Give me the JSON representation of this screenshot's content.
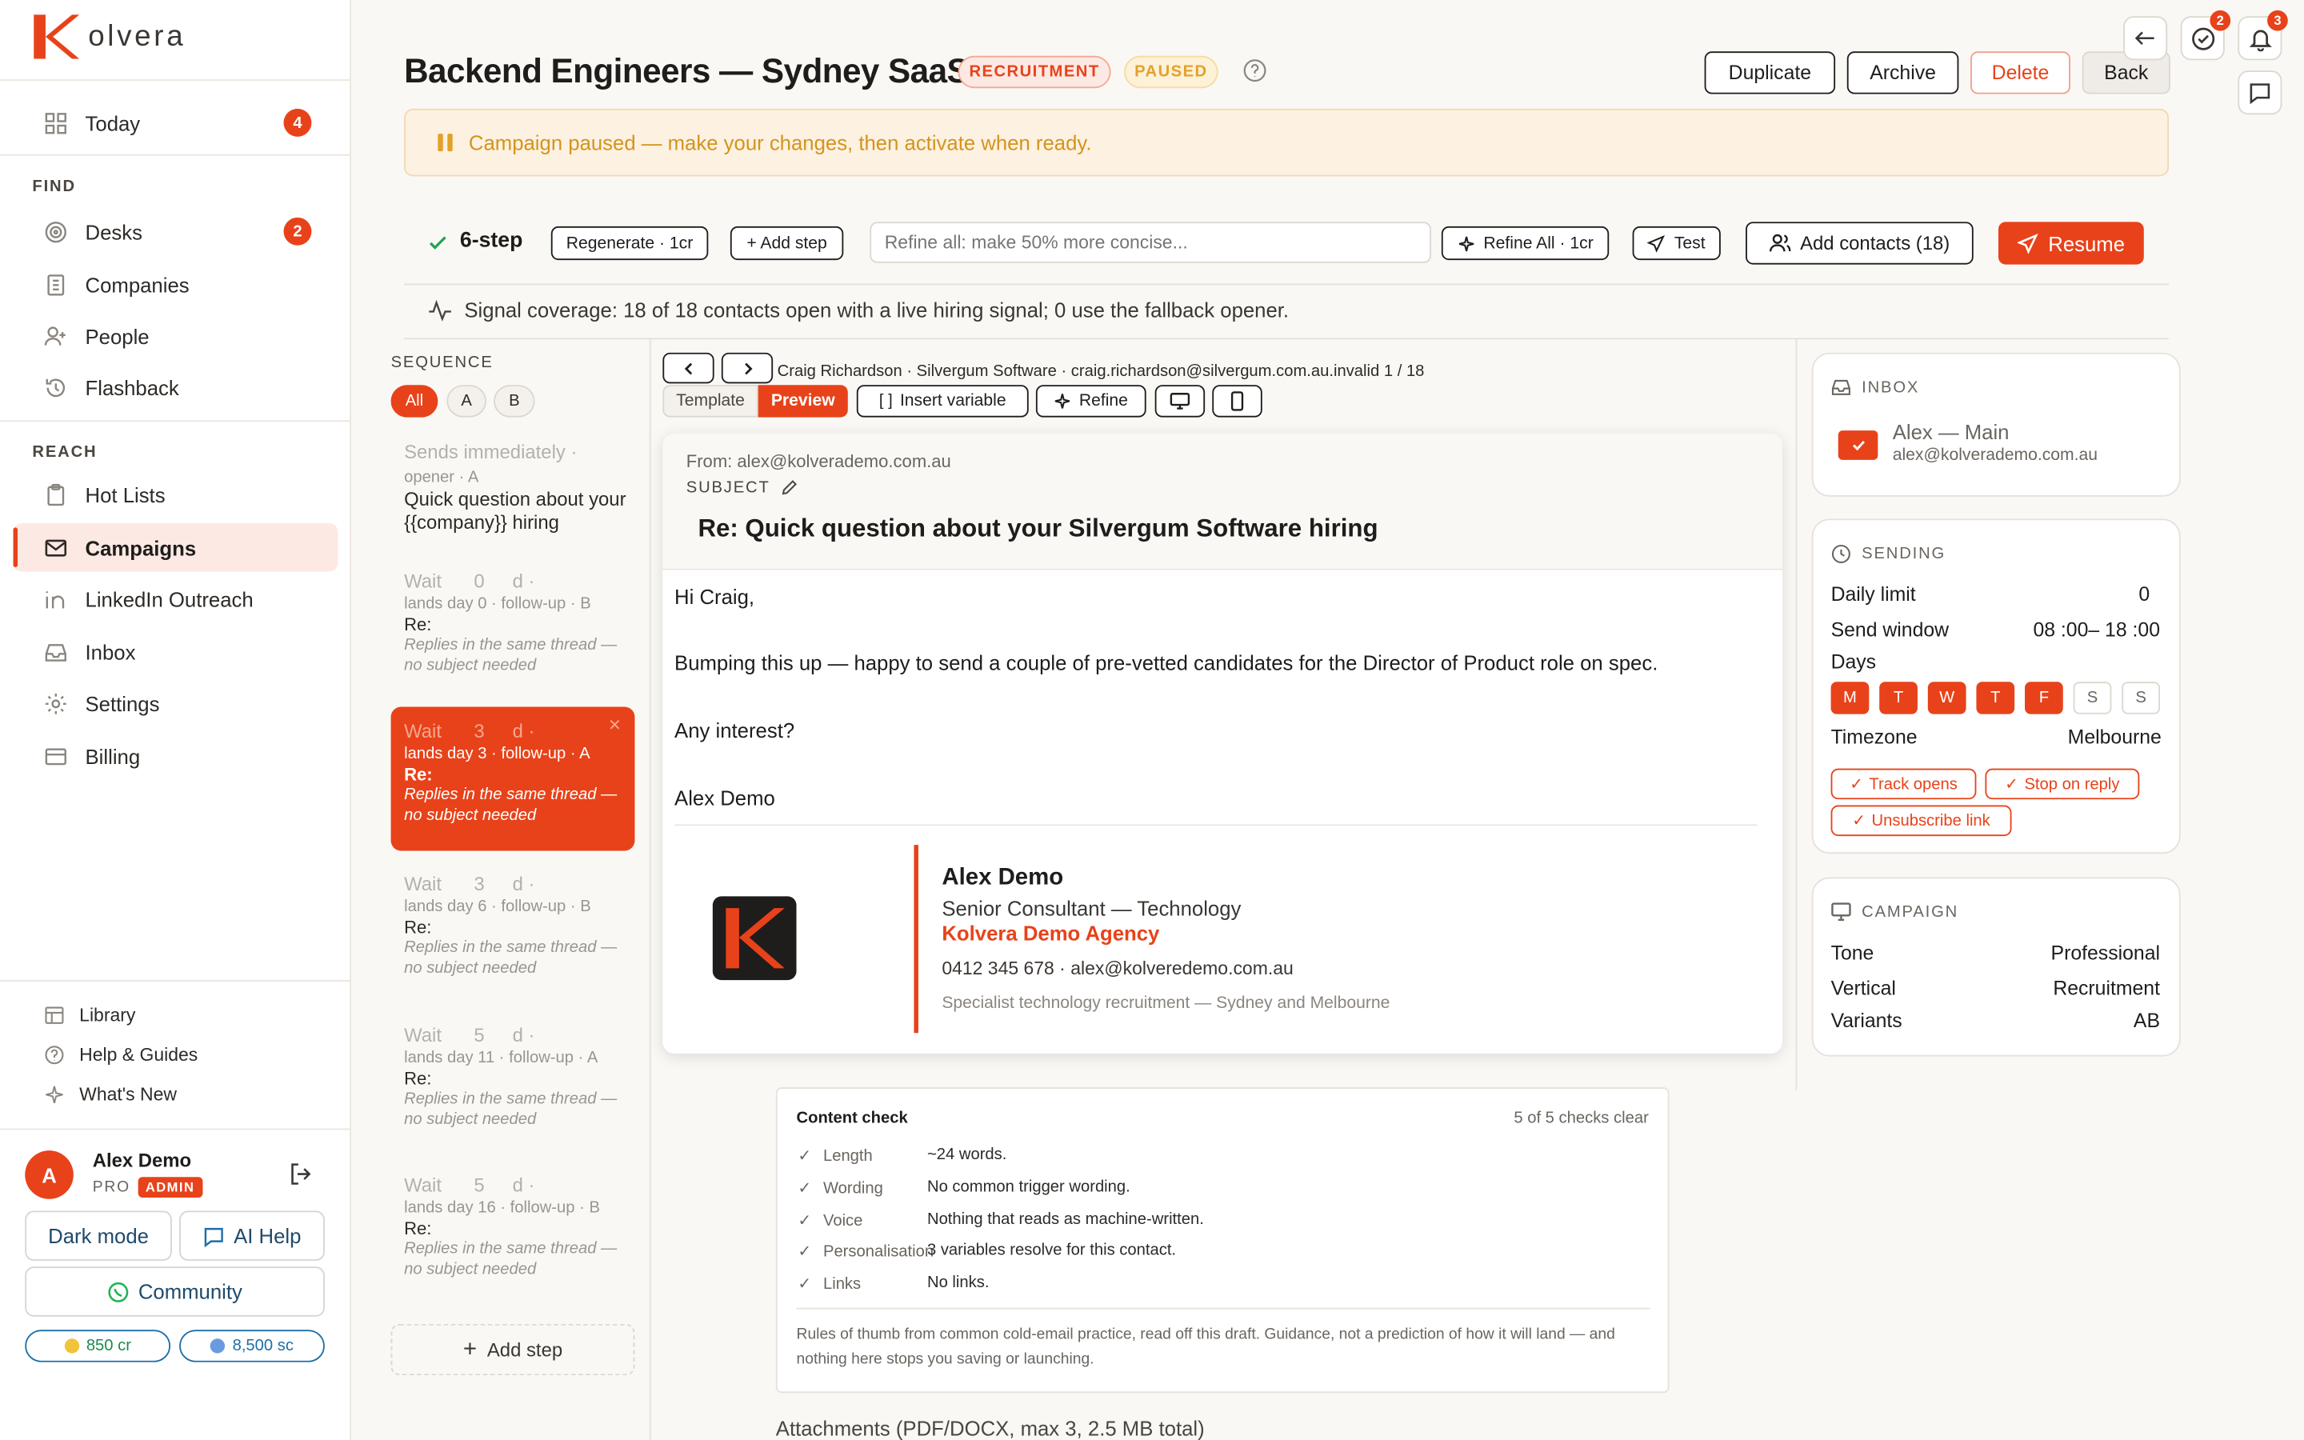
{
  "app": {
    "brand": "olvera",
    "accent": "#e8421a"
  },
  "sidebar": {
    "today": {
      "label": "Today",
      "badge": "4"
    },
    "find_heading": "FIND",
    "find_items": [
      {
        "label": "Desks",
        "badge": "2",
        "icon": "target-icon"
      },
      {
        "label": "Companies",
        "icon": "building-icon"
      },
      {
        "label": "People",
        "icon": "person-add-icon"
      },
      {
        "label": "Flashback",
        "icon": "history-icon"
      }
    ],
    "reach_heading": "REACH",
    "reach_items": [
      {
        "label": "Hot Lists",
        "icon": "clipboard-icon"
      },
      {
        "label": "Campaigns",
        "icon": "mail-icon",
        "active": true
      },
      {
        "label": "LinkedIn Outreach",
        "icon": "linkedin-icon"
      },
      {
        "label": "Inbox",
        "icon": "inbox-icon"
      },
      {
        "label": "Settings",
        "icon": "gear-icon"
      },
      {
        "label": "Billing",
        "icon": "card-icon"
      }
    ],
    "bottom_items": [
      {
        "label": "Library",
        "icon": "library-icon"
      },
      {
        "label": "Help & Guides",
        "icon": "help-icon"
      },
      {
        "label": "What's New",
        "icon": "sparkle-icon"
      }
    ],
    "user": {
      "initial": "A",
      "name": "Alex Demo",
      "plan": "PRO",
      "role": "ADMIN"
    },
    "dark_mode": "Dark mode",
    "ai_help": "AI Help",
    "community": "Community",
    "credits": "850 cr",
    "sc": "8,500 sc"
  },
  "header": {
    "title": "Backend Engineers — Sydney SaaS",
    "tag1": "RECRUITMENT",
    "tag2": "PAUSED",
    "duplicate": "Duplicate",
    "archive": "Archive",
    "delete": "Delete",
    "back": "Back",
    "tasks_badge": "2",
    "notif_badge": "3"
  },
  "banner": "Campaign paused — make your changes, then activate when ready.",
  "toolbar": {
    "steps": "6-step",
    "regenerate": "Regenerate · 1cr",
    "add_step": "+ Add step",
    "refine_placeholder": "Refine all: make 50% more concise...",
    "refine_all": "Refine All · 1cr",
    "test": "Test",
    "add_contacts": "Add contacts (18)",
    "resume": "Resume"
  },
  "signal": "Signal coverage: 18 of 18 contacts open with a live hiring signal; 0 use the fallback opener.",
  "sequence": {
    "heading": "SEQUENCE",
    "filters": [
      "All",
      "A",
      "B"
    ],
    "first": {
      "row1": "Sends immediately ·",
      "meta": "opener · A",
      "subject": "Quick question about your {{company}} hiring"
    },
    "steps": [
      {
        "wait": "Wait",
        "days": "0",
        "unit": "d ·",
        "meta": "lands day 0 · follow-up · B",
        "re": "Re:",
        "reply": "Replies in the same thread — no subject needed"
      },
      {
        "wait": "Wait",
        "days": "3",
        "unit": "d ·",
        "meta": "lands day 3 · follow-up · A",
        "re": "Re:",
        "reply": "Replies in the same thread — no subject needed"
      },
      {
        "wait": "Wait",
        "days": "3",
        "unit": "d ·",
        "meta": "lands day 6 · follow-up · B",
        "re": "Re:",
        "reply": "Replies in the same thread — no subject needed"
      },
      {
        "wait": "Wait",
        "days": "5",
        "unit": "d ·",
        "meta": "lands day 11 · follow-up · A",
        "re": "Re:",
        "reply": "Replies in the same thread — no subject needed"
      },
      {
        "wait": "Wait",
        "days": "5",
        "unit": "d ·",
        "meta": "lands day 16 · follow-up · B",
        "re": "Re:",
        "reply": "Replies in the same thread — no subject needed"
      }
    ],
    "add_step": "Add step"
  },
  "editor": {
    "contact": "Craig Richardson · Silvergum Software · craig.richardson@silvergum.com.au.invalid 1 / 18",
    "tab_template": "Template",
    "tab_preview": "Preview",
    "insert_variable": "Insert variable",
    "refine": "Refine",
    "from": "From: alex@kolverademo.com.au",
    "subject_label": "SUBJECT",
    "subject": "Re: Quick question about your Silvergum Software hiring",
    "greeting": "Hi Craig,",
    "para1": "Bumping this up — happy to send a couple of pre-vetted candidates for the Director of Product role on spec.",
    "para2": "Any interest?",
    "signoff": "Alex Demo",
    "sig": {
      "name": "Alex Demo",
      "role": "Senior Consultant — Technology",
      "agency": "Kolvera Demo Agency",
      "contact": "0412 345 678 · alex@kolveredemo.com.au",
      "tagline": "Specialist technology recruitment — Sydney and Melbourne"
    }
  },
  "content_check": {
    "title": "Content check",
    "summary": "5 of 5 checks clear",
    "rows": [
      {
        "k": "Length",
        "v": "~24 words."
      },
      {
        "k": "Wording",
        "v": "No common trigger wording."
      },
      {
        "k": "Voice",
        "v": "Nothing that reads as machine-written."
      },
      {
        "k": "Personalisation",
        "v": "3 variables resolve for this contact."
      },
      {
        "k": "Links",
        "v": "No links."
      }
    ],
    "note": "Rules of thumb from common cold-email practice, read off this draft. Guidance, not a prediction of how it will land — and nothing here stops you saving or launching."
  },
  "attachments": "Attachments (PDF/DOCX, max 3, 2.5 MB total)",
  "inbox": {
    "heading": "INBOX",
    "name": "Alex — Main",
    "email": "alex@kolverademo.com.au"
  },
  "sending": {
    "heading": "SENDING",
    "daily_limit_label": "Daily limit",
    "daily_limit": "0",
    "window_label": "Send window",
    "window": "08 :00– 18 :00",
    "days_label": "Days",
    "days": [
      "M",
      "T",
      "W",
      "T",
      "F",
      "S",
      "S"
    ],
    "timezone_label": "Timezone",
    "timezone": "Melbourne",
    "track_opens": "Track opens",
    "stop_on_reply": "Stop on reply",
    "unsubscribe": "Unsubscribe link"
  },
  "campaign": {
    "heading": "CAMPAIGN",
    "tone_label": "Tone",
    "tone": "Professional",
    "vertical_label": "Vertical",
    "vertical": "Recruitment",
    "variants_label": "Variants",
    "variants": "AB"
  }
}
